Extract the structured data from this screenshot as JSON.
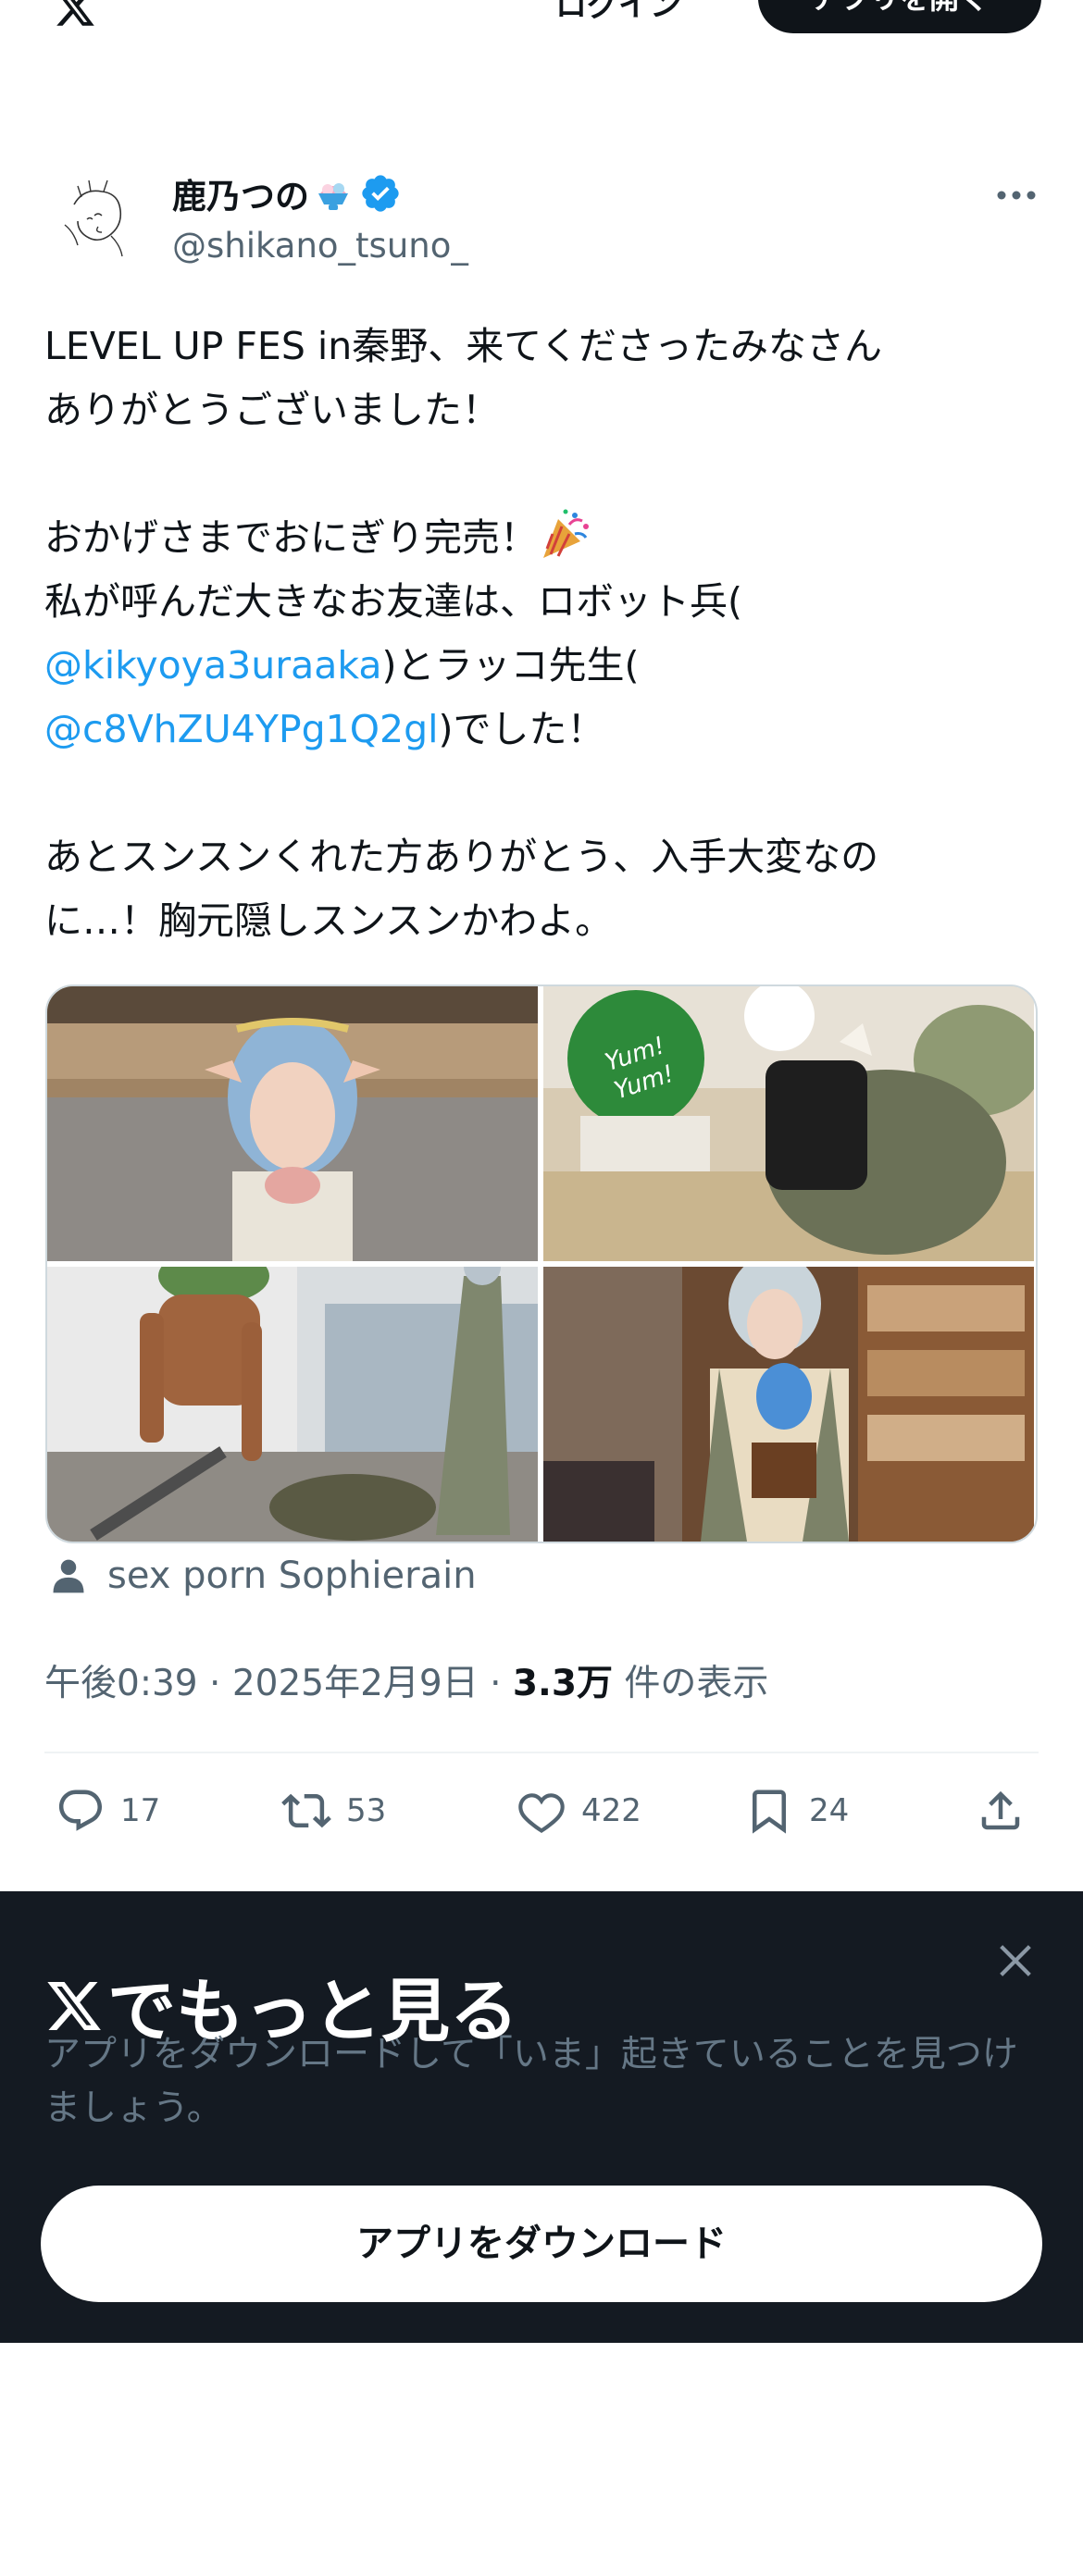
{
  "header": {
    "login_label": "ログイン",
    "open_app_label": "アプリを開く"
  },
  "author": {
    "display_name": "鹿乃つの",
    "name_emoji": "shaved-ice-icon",
    "verified": true,
    "handle": "@shikano_tsuno_"
  },
  "tweet": {
    "lines": [
      [
        "LEVEL UP FES in秦野、来てくださったみなさん"
      ],
      [
        "ありがとうございました！"
      ],
      [
        ""
      ],
      [
        "おかげさまでおにぎり完売！"
      ],
      [
        "私が呼んだ大きなお友達は、ロボット兵("
      ],
      [
        "@kikyoya3uraaka",
        ")とラッコ先生("
      ],
      [
        "@c8VhZU4YPg1Q2gl",
        ")でした！"
      ],
      [
        ""
      ],
      [
        "あとスンスンくれた方ありがとう、入手大変なの"
      ],
      [
        "に…！胸元隠しスンスンかわよ。"
      ]
    ],
    "mention_1": "@kikyoya3uraaka",
    "mention_1_after": ")とラッコ先生(",
    "mention_2": "@c8VhZU4YPg1Q2gl",
    "mention_2_after": ")でした！",
    "line_1": "LEVEL UP FES in秦野、来てくださったみなさん",
    "line_2": "ありがとうございました！",
    "line_4": "おかげさまでおにぎり完売！",
    "line_5": "私が呼んだ大きなお友達は、ロボット兵(",
    "line_9": "あとスンスンくれた方ありがとう、入手大変なの",
    "line_10": "に…！胸元隠しスンスンかわよ。",
    "photo_sign_text": "Yum! Yum!"
  },
  "tagged_user": "sex porn Sophierain",
  "meta": {
    "time": "午後0:39",
    "date": "2025年2月9日",
    "views_count": "3.3万",
    "views_label": "件の表示",
    "separator": "·"
  },
  "actions": {
    "replies": "17",
    "reposts": "53",
    "likes": "422",
    "bookmarks": "24"
  },
  "sheet": {
    "title": "でもっと見る",
    "description": "アプリをダウンロードして「いま」起きていることを見つけましょう。",
    "download_label": "アプリをダウンロード"
  },
  "colors": {
    "link": "#1d9bf0",
    "text": "#0f1419",
    "muted": "#536471",
    "sheet_bg": "#141a22"
  }
}
